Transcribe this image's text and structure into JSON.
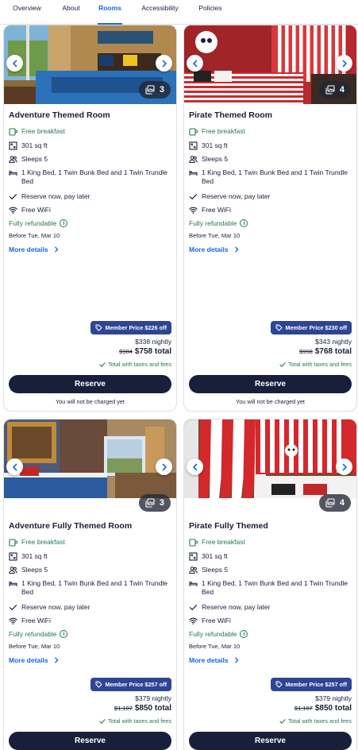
{
  "tabs": [
    {
      "label": "Overview"
    },
    {
      "label": "About"
    },
    {
      "label": "Rooms"
    },
    {
      "label": "Accessibility"
    },
    {
      "label": "Policies"
    }
  ],
  "rooms": [
    {
      "title": "Adventure Themed Room",
      "photo_count": "3",
      "breakfast": "Free breakfast",
      "area": "301 sq ft",
      "sleeps": "Sleeps 5",
      "beds": "1 King Bed, 1 Twin Bunk Bed and 1 Twin Trundle Bed",
      "reserve_later": "Reserve now, pay later",
      "wifi": "Free WiFi",
      "refundable": "Fully refundable",
      "before": "Before Tue, Mar 10",
      "more_details": "More details",
      "member_price": "Member Price $226 off",
      "nightly": "$338 nightly",
      "old_total": "$984",
      "total": "$758 total",
      "taxes": "Total with taxes and fees",
      "reserve": "Reserve",
      "not_charged": "You will not be charged yet"
    },
    {
      "title": "Pirate Themed Room",
      "photo_count": "4",
      "breakfast": "Free breakfast",
      "area": "301 sq ft",
      "sleeps": "Sleeps 5",
      "beds": "1 King Bed, 1 Twin Bunk Bed and 1 Twin Trundle Bed",
      "reserve_later": "Reserve now, pay later",
      "wifi": "Free WiFi",
      "refundable": "Fully refundable",
      "before": "Before Tue, Mar 10",
      "more_details": "More details",
      "member_price": "Member Price $230 off",
      "nightly": "$343 nightly",
      "old_total": "$998",
      "total": "$768 total",
      "taxes": "Total with taxes and fees",
      "reserve": "Reserve",
      "not_charged": "You will not be charged yet"
    },
    {
      "title": "Adventure Fully Themed Room",
      "photo_count": "3",
      "breakfast": "Free breakfast",
      "area": "301 sq ft",
      "sleeps": "Sleeps 5",
      "beds": "1 King Bed, 1 Twin Bunk Bed and 1 Twin Trundle Bed",
      "reserve_later": "Reserve now, pay later",
      "wifi": "Free WiFi",
      "refundable": "Fully refundable",
      "before": "Before Tue, Mar 10",
      "more_details": "More details",
      "member_price": "Member Price $257 off",
      "nightly": "$379 nightly",
      "old_total": "$1,107",
      "total": "$850 total",
      "taxes": "Total with taxes and fees",
      "reserve": "Reserve"
    },
    {
      "title": "Pirate Fully Themed",
      "photo_count": "4",
      "breakfast": "Free breakfast",
      "area": "301 sq ft",
      "sleeps": "Sleeps 5",
      "beds": "1 King Bed, 1 Twin Bunk Bed and 1 Twin Trundle Bed",
      "reserve_later": "Reserve now, pay later",
      "wifi": "Free WiFi",
      "refundable": "Fully refundable",
      "before": "Before Tue, Mar 10",
      "more_details": "More details",
      "member_price": "Member Price $257 off",
      "nightly": "$379 nightly",
      "old_total": "$1,107",
      "total": "$850 total",
      "taxes": "Total with taxes and fees",
      "reserve": "Reserve"
    }
  ],
  "icons": {
    "carousel_prev": "chevron-left-icon",
    "carousel_next": "chevron-right-icon",
    "photo_gallery": "gallery-icon",
    "breakfast": "coffee-cup-icon",
    "area": "expand-icon",
    "sleeps": "people-icon",
    "beds": "bed-icon",
    "reserve_later": "checkmark-icon",
    "wifi": "wifi-icon",
    "member": "tag-icon"
  },
  "colors": {
    "brand_blue": "#1668e3",
    "navy": "#191e3b",
    "member_badge": "#2d4594",
    "green": "#227950"
  }
}
